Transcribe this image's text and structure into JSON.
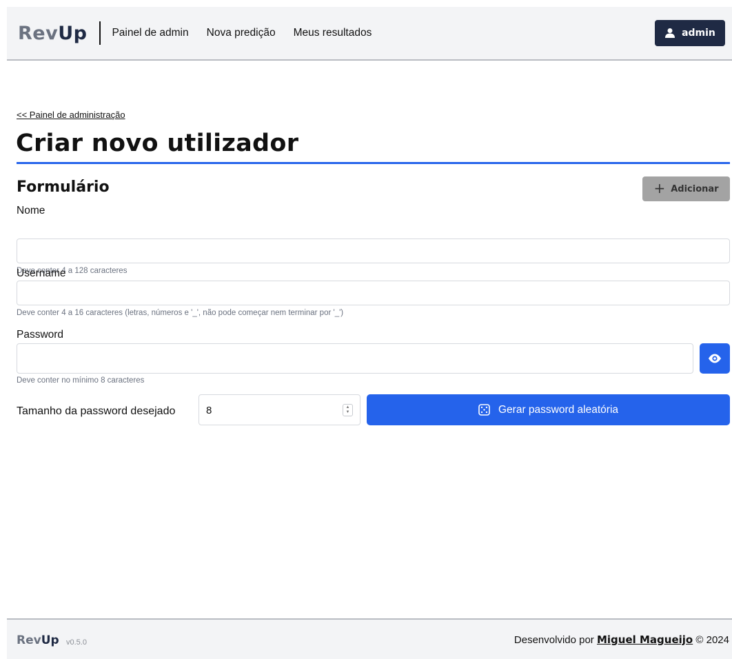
{
  "brand": {
    "part1": "Rev",
    "part2": "Up"
  },
  "nav": {
    "links": [
      "Painel de admin",
      "Nova predição",
      "Meus resultados"
    ],
    "user_label": "admin"
  },
  "breadcrumb": "<< Painel de administração",
  "page_title": "Criar novo utilizador",
  "form": {
    "section_title": "Formulário",
    "add_button": "Adicionar",
    "name": {
      "label": "Nome",
      "value": "",
      "hint": "Deve conter 4 a 128 caracteres"
    },
    "username": {
      "label": "Username",
      "value": "",
      "hint": "Deve conter 4 a 16 caracteres (letras, números e '_', não pode começar nem terminar por '_')"
    },
    "password": {
      "label": "Password",
      "value": "",
      "hint": "Deve conter no mínimo 8 caracteres"
    },
    "password_size": {
      "label": "Tamanho da password desejado",
      "value": "8"
    },
    "generate_button": "Gerar password aleatória"
  },
  "footer": {
    "version": "v0.5.0",
    "credit_prefix": "Desenvolvido por",
    "author": "Miguel Magueijo",
    "credit_suffix": "© 2024"
  },
  "icons": [
    "user-icon",
    "plus-icon",
    "eye-icon",
    "dice-icon",
    "spinner-icon"
  ],
  "colors": {
    "primary": "#2563eb",
    "brand_dark": "#1f2a44",
    "brand_grey": "#6b7280",
    "disabled_button": "#a3a3a3"
  }
}
